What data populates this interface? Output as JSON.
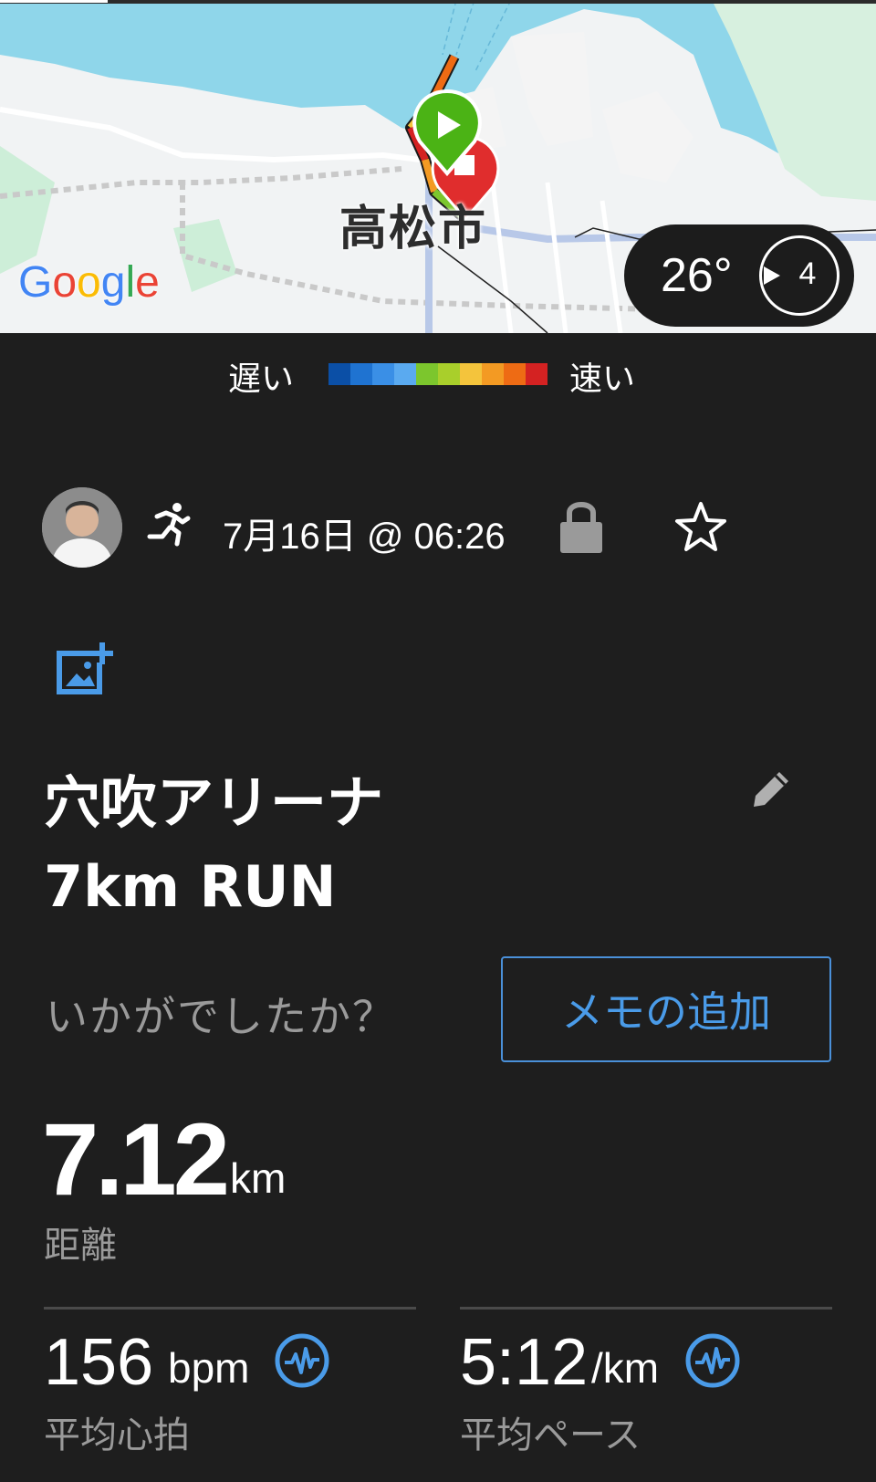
{
  "map": {
    "city_label": "高松市",
    "google_logo": [
      "G",
      "o",
      "o",
      "g",
      "l",
      "e"
    ],
    "google_colors": [
      "#4285F4",
      "#EA4335",
      "#FBBC05",
      "#4285F4",
      "#34A853",
      "#EA4335"
    ],
    "weather": {
      "temperature": "26°",
      "wind_speed": "4"
    },
    "start_marker_icon": "play-icon",
    "finish_marker_icon": "finish-flag-icon"
  },
  "speed_legend": {
    "slow_label": "遅い",
    "fast_label": "速い",
    "colors": [
      "#0b4fa6",
      "#1f73d1",
      "#3a8fe6",
      "#5aaaf0",
      "#7cc62d",
      "#a9cf2b",
      "#f4c43c",
      "#f39a23",
      "#ee6b14",
      "#d42222"
    ]
  },
  "activity": {
    "activity_type_icon": "running-icon",
    "date_time": "7月16日 @ 06:26",
    "privacy_icon": "lock-icon",
    "favorite_icon": "star-icon",
    "title": "穴吹アリーナ\n 7km RUN",
    "memo_prompt": "いかがでしたか？",
    "memo_button_label": "メモの追加"
  },
  "stats": {
    "distance": {
      "value": "7.12",
      "unit": "km",
      "label": "距離"
    },
    "heart_rate": {
      "value": "156",
      "unit": "bpm",
      "label": "平均心拍"
    },
    "pace": {
      "value": "5:12",
      "unit": "/km",
      "label": "平均ペース"
    }
  },
  "colors": {
    "background": "#1e1e1e",
    "accent_blue": "#4a9be8",
    "muted_text": "#9a9a9a"
  }
}
